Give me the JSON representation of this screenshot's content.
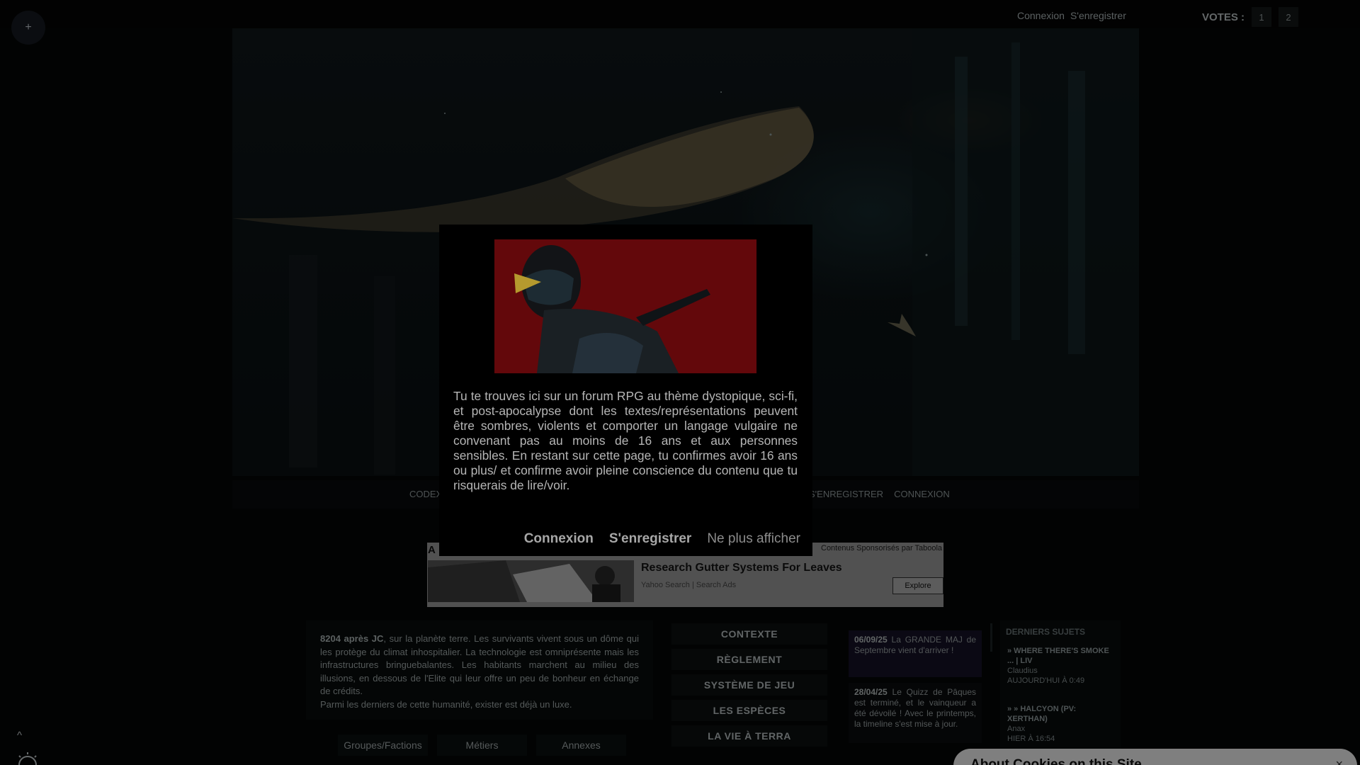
{
  "topbar": {
    "fab_glyph": "+",
    "login": "Connexion",
    "register": "S'enregistrer",
    "votes_label": "VOTES :",
    "votes": [
      "1",
      "2"
    ]
  },
  "nav": {
    "left": "CODEX",
    "right": [
      "S'ENREGISTRER",
      "CONNEXION"
    ]
  },
  "ad": {
    "letter": "A",
    "sponsor": "Contenus Sponsorisés par Taboola",
    "title": "Research Gutter Systems For Leaves",
    "source": "Yahoo Search | Search Ads",
    "button": "Explore"
  },
  "intro": {
    "strong": "8204 après JC",
    "text": ", sur la planète terre. Les survivants vivent sous un dôme qui les protège du climat inhospitalier. La technologie est omniprésente mais les infrastructures bringuebalantes. Les habitants marchent au milieu des illusions, en dessous de l'Elite qui leur offre un peu de bonheur en échange de crédits.",
    "line2": "Parmi les derniers de cette humanité, exister est déjà un luxe."
  },
  "tabs": [
    "Groupes/Factions",
    "Métiers",
    "Annexes"
  ],
  "menu": [
    "CONTEXTE",
    "RÈGLEMENT",
    "SYSTÈME DE JEU",
    "LES ESPÈCES",
    "LA VIE À TERRA"
  ],
  "news": [
    {
      "date": "06/09/25",
      "text": " La GRANDE MAJ de Septembre vient d'arriver !"
    },
    {
      "date": "28/04/25",
      "text": " Le Quizz de Pâques est terminé, et le vainqueur a été dévoilé ! Avec le printemps, la timeline s'est mise à jour."
    }
  ],
  "latest": {
    "title": "DERNIERS SUJETS",
    "topics": [
      {
        "title": "» WHERE THERE'S SMOKE ... | LIV",
        "author": "Claudius",
        "time": "AUJOURD'HUI À 0:49"
      },
      {
        "title": "» » HALCYON (PV: XERTHAN)",
        "author": "Anax",
        "time": "HIER À 16:54"
      }
    ]
  },
  "scrolltop_glyph": "^",
  "cookie": {
    "title": "About Cookies on this Site",
    "close_glyph": "×"
  },
  "modal": {
    "warning": "Tu te trouves ici sur un forum RPG au thème dystopique, sci-fi, et post-apocalypse dont les textes/représentations peuvent être sombres, violents et comporter un langage vulgaire ne convenant pas au moins de 16 ans et aux personnes sensibles. En restant sur cette page, tu confirmes avoir 16 ans ou plus/ et confirme avoir pleine conscience du contenu que tu risquerais de lire/voir.",
    "login": "Connexion",
    "register": "S'enregistrer",
    "dismiss": "Ne plus afficher"
  },
  "colors": {
    "modal_bg": "#000000",
    "overlay": "rgba(0,0,0,0.5)",
    "modal_image_red": "#7e0d10",
    "news_highlight": "#161229"
  }
}
